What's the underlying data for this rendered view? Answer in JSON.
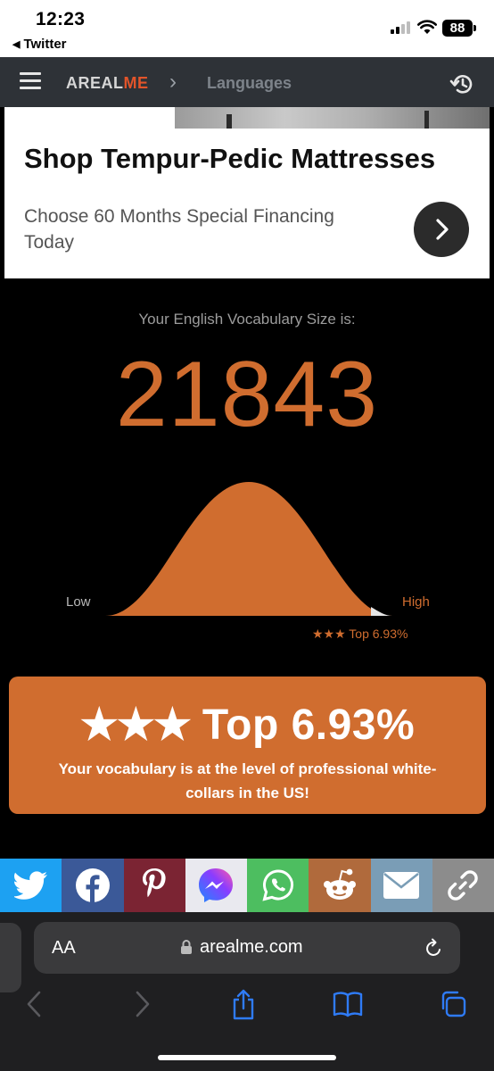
{
  "status_bar": {
    "time": "12:23",
    "back_app": "Twitter",
    "battery": "88"
  },
  "header": {
    "logo_primary": "AREAL",
    "logo_accent": "ME",
    "breadcrumb_sep": "›",
    "breadcrumb": "Languages"
  },
  "ad": {
    "title": "Shop Tempur-Pedic Mattresses",
    "subtitle": "Choose 60 Months Special Financing Today"
  },
  "result": {
    "label": "Your English Vocabulary Size is:",
    "score": "21843",
    "low_label": "Low",
    "high_label": "High",
    "rank_small": "★★★ Top 6.93%",
    "box_stars": "★★★",
    "box_rank": "Top 6.93%",
    "box_desc": "Your vocabulary is at the level of professional white-collars in the US!",
    "percentile_top": 6.93
  },
  "share": [
    {
      "name": "twitter",
      "icon": "twitter-icon",
      "color": "#1da1f2"
    },
    {
      "name": "facebook",
      "icon": "facebook-icon",
      "color": "#3b5998"
    },
    {
      "name": "pinterest",
      "icon": "pinterest-icon",
      "color": "#7b2433"
    },
    {
      "name": "messenger",
      "icon": "messenger-icon",
      "color": "#e9e9ef"
    },
    {
      "name": "whatsapp",
      "icon": "whatsapp-icon",
      "color": "#4dbe60"
    },
    {
      "name": "reddit",
      "icon": "reddit-icon",
      "color": "#b06a3c"
    },
    {
      "name": "email",
      "icon": "email-icon",
      "color": "#7a9db6"
    },
    {
      "name": "copy-link",
      "icon": "link-icon",
      "color": "#8c8c8c"
    }
  ],
  "safari": {
    "text_size": "AA",
    "url": "arealme.com"
  },
  "colors": {
    "accent": "#d06d2f",
    "header_bg": "#2e3237",
    "brand_red": "#e2542a"
  }
}
